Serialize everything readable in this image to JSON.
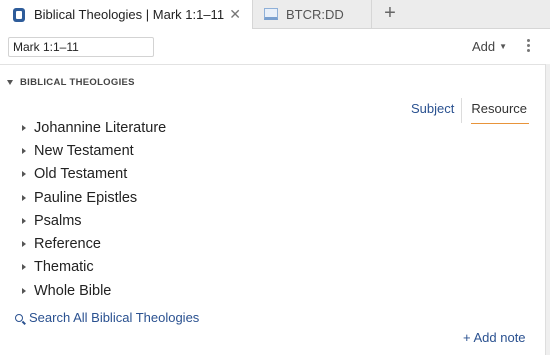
{
  "tabs": [
    {
      "label": "Biblical Theologies | Mark 1:1–11",
      "icon": "biblical-theologies-icon",
      "active": true,
      "close": "✕"
    },
    {
      "label": "BTCR:DD",
      "icon": "book-icon",
      "active": false
    }
  ],
  "new_tab": "+",
  "toolbar": {
    "reference_value": "Mark 1:1–11",
    "add_label": "Add",
    "add_caret": "▼"
  },
  "section": {
    "title": "BIBLICAL THEOLOGIES",
    "modes": {
      "subject": "Subject",
      "resource": "Resource",
      "selected": "Resource"
    },
    "items": [
      "Johannine Literature",
      "New Testament",
      "Old Testament",
      "Pauline Epistles",
      "Psalms",
      "Reference",
      "Thematic",
      "Whole Bible"
    ],
    "search_link": "Search All Biblical Theologies"
  },
  "add_note": "+ Add note",
  "colors": {
    "link_blue": "#2a5190",
    "resource_underline": "#e8943a",
    "tab_icon": "#2e5c9a"
  }
}
